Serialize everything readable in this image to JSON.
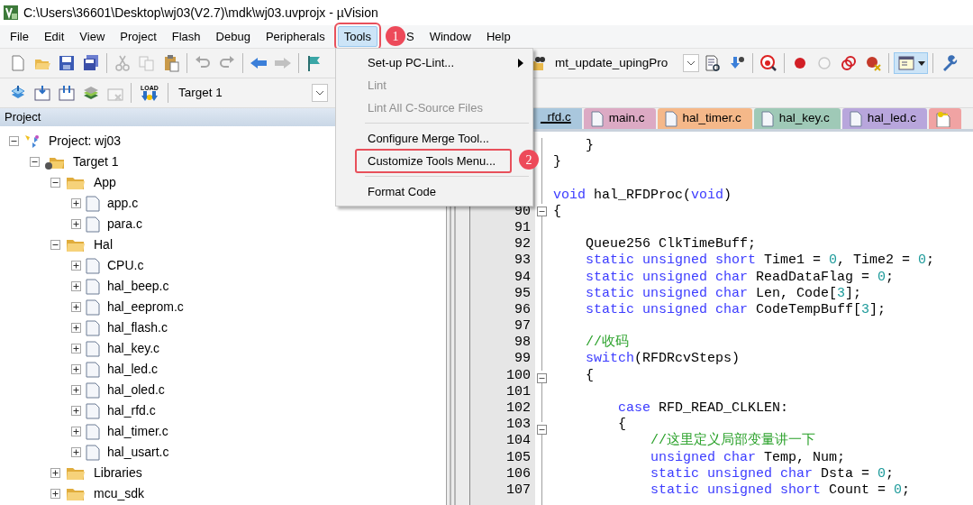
{
  "window": {
    "title": "C:\\Users\\36601\\Desktop\\wj03(V2.7)\\mdk\\wj03.uvprojx - µVision"
  },
  "menu_bar": [
    {
      "label": "File",
      "selected": false,
      "annotated": false
    },
    {
      "label": "Edit",
      "selected": false,
      "annotated": false
    },
    {
      "label": "View",
      "selected": false,
      "annotated": false
    },
    {
      "label": "Project",
      "selected": false,
      "annotated": false
    },
    {
      "label": "Flash",
      "selected": false,
      "annotated": false
    },
    {
      "label": "Debug",
      "selected": false,
      "annotated": false
    },
    {
      "label": "Peripherals",
      "selected": false,
      "annotated": false
    },
    {
      "label": "Tools",
      "selected": true,
      "annotated": true
    },
    {
      "label": "S",
      "selected": false,
      "annotated": false
    },
    {
      "label": "Window",
      "selected": false,
      "annotated": false
    },
    {
      "label": "Help",
      "selected": false,
      "annotated": false
    }
  ],
  "tools_menu": [
    {
      "kind": "item",
      "label": "Set-up PC-Lint...",
      "disabled": false,
      "submenu": true,
      "annotated": false
    },
    {
      "kind": "item",
      "label": "Lint",
      "disabled": true,
      "submenu": false,
      "annotated": false
    },
    {
      "kind": "item",
      "label": "Lint All C-Source Files",
      "disabled": true,
      "submenu": false,
      "annotated": false
    },
    {
      "kind": "separator"
    },
    {
      "kind": "item",
      "label": "Configure Merge Tool...",
      "disabled": false,
      "submenu": false,
      "annotated": false
    },
    {
      "kind": "item",
      "label": "Customize Tools Menu...",
      "disabled": false,
      "submenu": false,
      "annotated": true
    },
    {
      "kind": "separator"
    },
    {
      "kind": "item",
      "label": "Format Code",
      "disabled": false,
      "submenu": false,
      "annotated": false
    }
  ],
  "callouts": [
    {
      "number": "1"
    },
    {
      "number": "2"
    }
  ],
  "toolbar_1": [
    {
      "kind": "new",
      "disabled": false
    },
    {
      "kind": "open",
      "disabled": false
    },
    {
      "kind": "save",
      "disabled": false
    },
    {
      "kind": "save-all",
      "disabled": false
    },
    {
      "kind": "sep"
    },
    {
      "kind": "cut",
      "disabled": true
    },
    {
      "kind": "copy",
      "disabled": true
    },
    {
      "kind": "paste",
      "disabled": false
    },
    {
      "kind": "sep"
    },
    {
      "kind": "undo",
      "disabled": true
    },
    {
      "kind": "redo",
      "disabled": true
    },
    {
      "kind": "sep"
    },
    {
      "kind": "back",
      "disabled": false
    },
    {
      "kind": "forward",
      "disabled": true
    },
    {
      "kind": "sep"
    },
    {
      "kind": "flag",
      "disabled": false
    }
  ],
  "toolbar_1_right": {
    "combo_value": "mt_update_upingPro",
    "tools": [
      {
        "kind": "find-doc",
        "disabled": false
      },
      {
        "kind": "download",
        "disabled": false
      },
      {
        "kind": "sep"
      },
      {
        "kind": "debug",
        "disabled": false
      },
      {
        "kind": "sep"
      },
      {
        "kind": "breakpoint",
        "disabled": false
      },
      {
        "kind": "circle",
        "disabled": true
      },
      {
        "kind": "circles",
        "disabled": false
      },
      {
        "kind": "breakpoint-x",
        "disabled": false
      },
      {
        "kind": "sep"
      },
      {
        "kind": "window",
        "disabled": false
      },
      {
        "kind": "sep"
      },
      {
        "kind": "wrench",
        "disabled": false
      }
    ]
  },
  "toolbar_2": {
    "tools": [
      {
        "kind": "build-stack",
        "disabled": false
      },
      {
        "kind": "build",
        "disabled": false
      },
      {
        "kind": "rebuild",
        "disabled": false
      },
      {
        "kind": "layers",
        "disabled": false
      },
      {
        "kind": "stop",
        "disabled": true
      },
      {
        "kind": "sep"
      },
      {
        "kind": "load",
        "disabled": false,
        "label": "LOAD"
      },
      {
        "kind": "sep"
      }
    ],
    "target": "Target 1"
  },
  "project_panel": {
    "title": "Project",
    "tree": [
      {
        "label": "Project: wj03",
        "kind": "project",
        "expanded": true,
        "children": [
          {
            "label": "Target 1",
            "kind": "target",
            "expanded": true,
            "children": [
              {
                "label": "App",
                "kind": "folder",
                "expanded": true,
                "children": [
                  {
                    "label": "app.c",
                    "kind": "file",
                    "expanded": false
                  },
                  {
                    "label": "para.c",
                    "kind": "file",
                    "expanded": false
                  }
                ]
              },
              {
                "label": "Hal",
                "kind": "folder",
                "expanded": true,
                "children": [
                  {
                    "label": "CPU.c",
                    "kind": "file",
                    "expanded": false
                  },
                  {
                    "label": "hal_beep.c",
                    "kind": "file",
                    "expanded": false
                  },
                  {
                    "label": "hal_eeprom.c",
                    "kind": "file",
                    "expanded": false
                  },
                  {
                    "label": "hal_flash.c",
                    "kind": "file",
                    "expanded": false
                  },
                  {
                    "label": "hal_key.c",
                    "kind": "file",
                    "expanded": false
                  },
                  {
                    "label": "hal_led.c",
                    "kind": "file",
                    "expanded": false
                  },
                  {
                    "label": "hal_oled.c",
                    "kind": "file",
                    "expanded": false
                  },
                  {
                    "label": "hal_rfd.c",
                    "kind": "file",
                    "expanded": false
                  },
                  {
                    "label": "hal_timer.c",
                    "kind": "file",
                    "expanded": false
                  },
                  {
                    "label": "hal_usart.c",
                    "kind": "file",
                    "expanded": false
                  }
                ]
              },
              {
                "label": "Libraries",
                "kind": "folder",
                "expanded": false
              },
              {
                "label": "mcu_sdk",
                "kind": "folder",
                "expanded": false
              }
            ]
          }
        ]
      }
    ]
  },
  "editor_tabs": [
    {
      "label": "_rfd.c",
      "selected": true,
      "color": "#a9c7dd"
    },
    {
      "label": "main.c",
      "selected": false,
      "color": "#dcaac4",
      "kind": "file"
    },
    {
      "label": "hal_timer.c",
      "selected": false,
      "color": "#f5b889",
      "kind": "file"
    },
    {
      "label": "hal_key.c",
      "selected": false,
      "color": "#9fc9b7",
      "kind": "file"
    },
    {
      "label": "hal_led.c",
      "selected": false,
      "color": "#b8a6dc",
      "kind": "file"
    },
    {
      "selected": false,
      "color": "#f0a3a3",
      "kind": "key"
    }
  ],
  "code_lines": [
    {
      "kind": "code",
      "tokens": [
        {
          "kind": "plain",
          "text": "    }"
        }
      ]
    },
    {
      "kind": "code",
      "tokens": [
        {
          "kind": "plain",
          "text": "}"
        }
      ]
    },
    {
      "kind": "blank"
    },
    {
      "kind": "code",
      "tokens": [
        {
          "kind": "kw",
          "text": "void"
        },
        {
          "kind": "plain",
          "text": " hal_RFDProc("
        },
        {
          "kind": "kw",
          "text": "void"
        },
        {
          "kind": "plain",
          "text": ")"
        }
      ]
    },
    {
      "number": "90",
      "fold": true,
      "tokens": [
        {
          "kind": "plain",
          "text": "{"
        }
      ]
    },
    {
      "number": "91"
    },
    {
      "number": "92",
      "tokens": [
        {
          "kind": "plain",
          "text": "    Queue256 ClkTimeBuff;"
        }
      ]
    },
    {
      "number": "93",
      "tokens": [
        {
          "kind": "kw",
          "text": "    static unsigned short"
        },
        {
          "kind": "plain",
          "text": " Time1 = "
        },
        {
          "kind": "num",
          "text": "0"
        },
        {
          "kind": "plain",
          "text": ", Time2 = "
        },
        {
          "kind": "num",
          "text": "0"
        },
        {
          "kind": "plain",
          "text": ";"
        }
      ]
    },
    {
      "number": "94",
      "tokens": [
        {
          "kind": "kw",
          "text": "    static unsigned char"
        },
        {
          "kind": "plain",
          "text": " ReadDataFlag = "
        },
        {
          "kind": "num",
          "text": "0"
        },
        {
          "kind": "plain",
          "text": ";"
        }
      ]
    },
    {
      "number": "95",
      "tokens": [
        {
          "kind": "kw",
          "text": "    static unsigned char"
        },
        {
          "kind": "plain",
          "text": " Len, Code["
        },
        {
          "kind": "num",
          "text": "3"
        },
        {
          "kind": "plain",
          "text": "];"
        }
      ]
    },
    {
      "number": "96",
      "tokens": [
        {
          "kind": "kw",
          "text": "    static unsigned char"
        },
        {
          "kind": "plain",
          "text": " CodeTempBuff["
        },
        {
          "kind": "num",
          "text": "3"
        },
        {
          "kind": "plain",
          "text": "];"
        }
      ]
    },
    {
      "number": "97"
    },
    {
      "number": "98",
      "tokens": [
        {
          "kind": "comment",
          "text": "    //收码"
        }
      ]
    },
    {
      "number": "99",
      "tokens": [
        {
          "kind": "kw",
          "text": "    switch"
        },
        {
          "kind": "plain",
          "text": "(RFDRcvSteps)"
        }
      ]
    },
    {
      "number": "100",
      "fold": true,
      "tokens": [
        {
          "kind": "plain",
          "text": "    {"
        }
      ]
    },
    {
      "number": "101"
    },
    {
      "number": "102",
      "tokens": [
        {
          "kind": "kw",
          "text": "        case"
        },
        {
          "kind": "plain",
          "text": " RFD_READ_CLKLEN:"
        }
      ]
    },
    {
      "number": "103",
      "fold": true,
      "tokens": [
        {
          "kind": "plain",
          "text": "        {"
        }
      ]
    },
    {
      "number": "104",
      "tokens": [
        {
          "kind": "comment",
          "text": "            //这里定义局部变量讲一下"
        }
      ]
    },
    {
      "number": "105",
      "tokens": [
        {
          "kind": "kw",
          "text": "            unsigned char"
        },
        {
          "kind": "plain",
          "text": " Temp, Num;"
        }
      ]
    },
    {
      "number": "106",
      "tokens": [
        {
          "kind": "kw",
          "text": "            static unsigned char"
        },
        {
          "kind": "plain",
          "text": " Dsta = "
        },
        {
          "kind": "num",
          "text": "0"
        },
        {
          "kind": "plain",
          "text": ";"
        }
      ]
    },
    {
      "number": "107",
      "tokens": [
        {
          "kind": "kw",
          "text": "            static unsigned short"
        },
        {
          "kind": "plain",
          "text": " Count = "
        },
        {
          "kind": "num",
          "text": "0"
        },
        {
          "kind": "plain",
          "text": ";"
        }
      ]
    }
  ]
}
